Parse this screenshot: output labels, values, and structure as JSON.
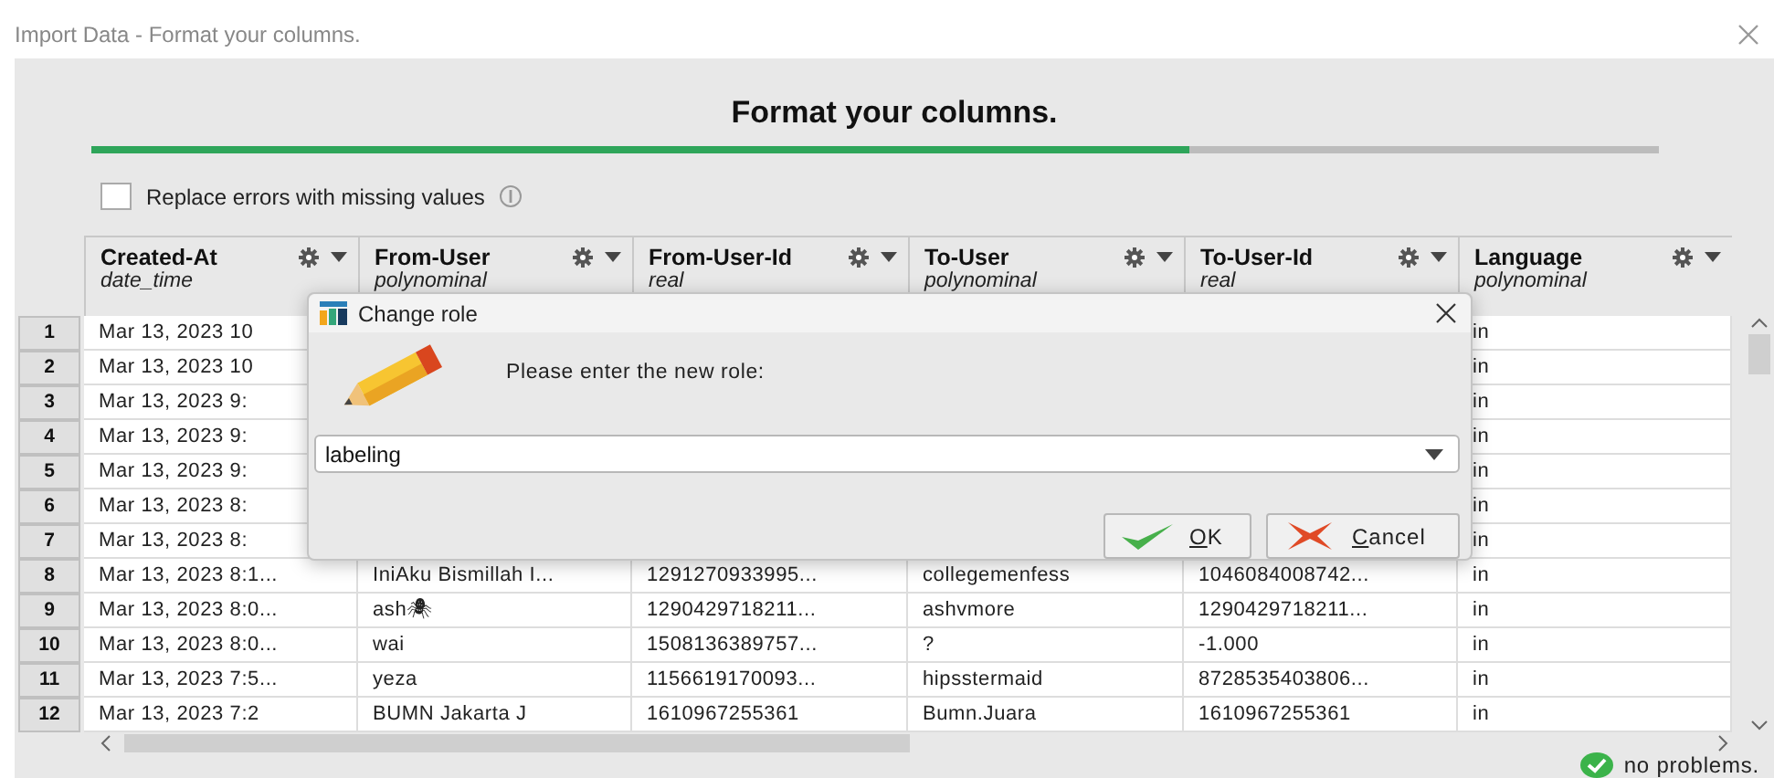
{
  "window": {
    "title": "Import Data - Format your columns."
  },
  "heading": "Format your columns.",
  "progress": {
    "level": 0.7
  },
  "replace_errors": {
    "label": "Replace errors with missing values",
    "checked": false
  },
  "table": {
    "columns": [
      {
        "name": "Created-At",
        "type": "date_time"
      },
      {
        "name": "From-User",
        "type": "polynominal"
      },
      {
        "name": "From-User-Id",
        "type": "real"
      },
      {
        "name": "To-User",
        "type": "polynominal"
      },
      {
        "name": "To-User-Id",
        "type": "real"
      },
      {
        "name": "Language",
        "type": "polynominal"
      }
    ],
    "rows": [
      {
        "number": "1",
        "kind": "covered",
        "cells": [
          "Mar 13, 2023 10",
          "in"
        ]
      },
      {
        "number": "2",
        "kind": "covered",
        "cells": [
          "Mar 13, 2023 10",
          "in"
        ]
      },
      {
        "number": "3",
        "kind": "covered",
        "cells": [
          "Mar 13, 2023 9:",
          "in"
        ]
      },
      {
        "number": "4",
        "kind": "covered",
        "cells": [
          "Mar 13, 2023 9:",
          "in"
        ]
      },
      {
        "number": "5",
        "kind": "covered",
        "cells": [
          "Mar 13, 2023 9:",
          "in"
        ]
      },
      {
        "number": "6",
        "kind": "covered",
        "cells": [
          "Mar 13, 2023 8:",
          "in"
        ]
      },
      {
        "number": "7",
        "kind": "covered",
        "cells": [
          "Mar 13, 2023 8:",
          "in"
        ]
      },
      {
        "number": "8",
        "kind": "full",
        "cells": [
          "Mar 13, 2023 8:1...",
          "IniAku Bismillah I...",
          "1291270933995...",
          "collegemenfess",
          "1046084008742...",
          "in"
        ]
      },
      {
        "number": "9",
        "kind": "full",
        "cells": [
          "Mar 13, 2023 8:0...",
          "ash🕷",
          "1290429718211...",
          "ashvmore",
          "1290429718211...",
          "in"
        ]
      },
      {
        "number": "10",
        "kind": "full",
        "cells": [
          "Mar 13, 2023 8:0...",
          "wai",
          "1508136389757...",
          "?",
          "-1.000",
          "in"
        ]
      },
      {
        "number": "11",
        "kind": "full",
        "cells": [
          "Mar 13, 2023 7:5...",
          "yeza",
          "1156619170093...",
          "hipsstermaid",
          "8728535403806...",
          "in"
        ]
      },
      {
        "number": "12",
        "kind": "full",
        "cells": [
          "Mar 13, 2023 7:2",
          "BUMN Jakarta J",
          "1610967255361",
          "Bumn.Juara",
          "1610967255361",
          "in"
        ]
      }
    ]
  },
  "dialog": {
    "title": "Change role",
    "prompt": "Please enter the new role:",
    "value": "labeling",
    "buttons": [
      {
        "kind": "ok",
        "label": "OK"
      },
      {
        "kind": "cancel",
        "label": "Cancel"
      }
    ]
  },
  "status": "no problems."
}
